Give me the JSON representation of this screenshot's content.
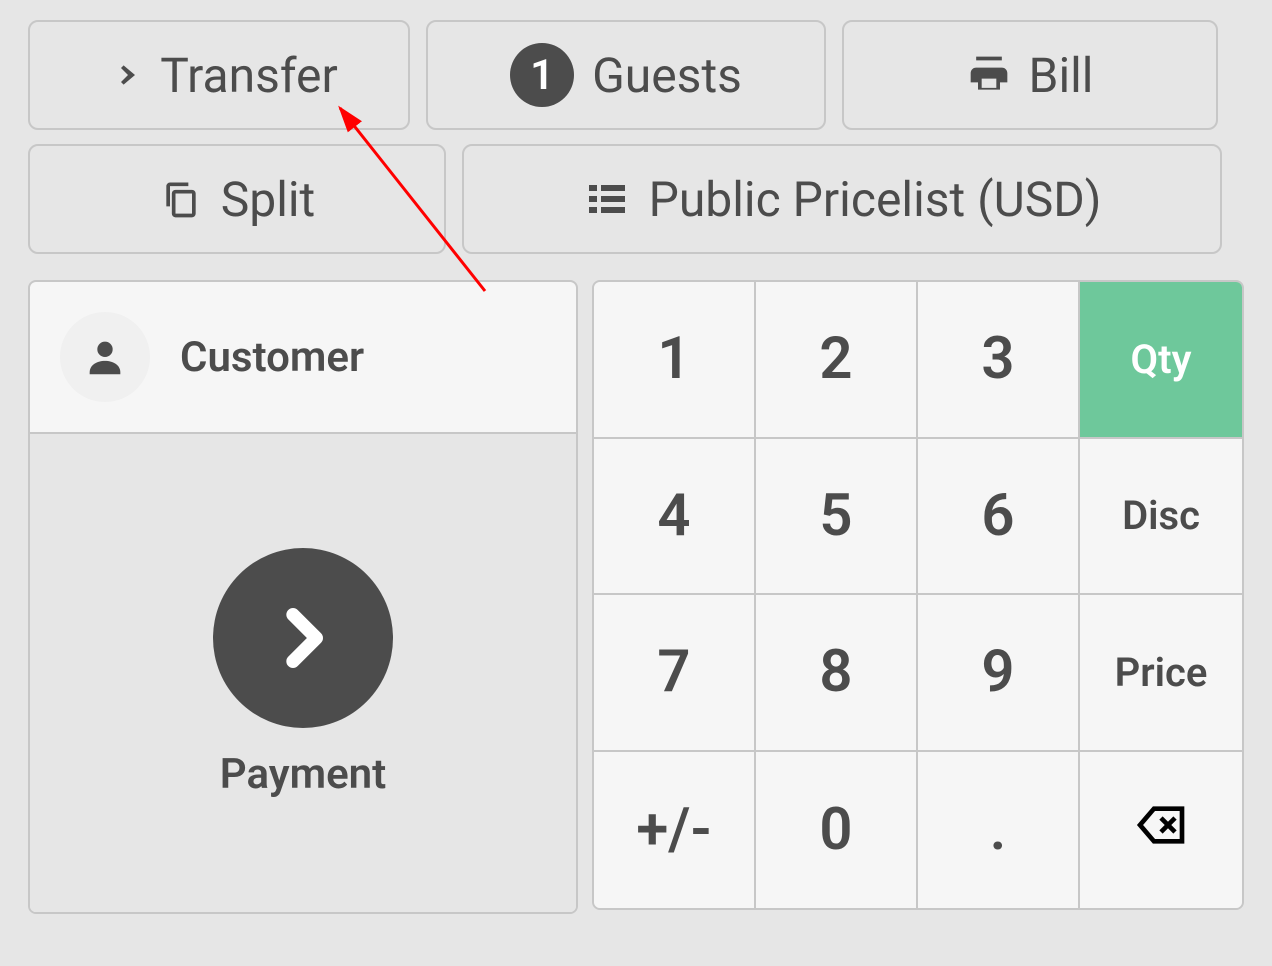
{
  "buttons": {
    "transfer": "Transfer",
    "guests": "Guests",
    "guests_count": "1",
    "bill": "Bill",
    "split": "Split",
    "pricelist": "Public Pricelist (USD)"
  },
  "customer": {
    "label": "Customer"
  },
  "payment": {
    "label": "Payment"
  },
  "numpad": {
    "k1": "1",
    "k2": "2",
    "k3": "3",
    "qty": "Qty",
    "k4": "4",
    "k5": "5",
    "k6": "6",
    "disc": "Disc",
    "k7": "7",
    "k8": "8",
    "k9": "9",
    "price": "Price",
    "pm": "+/-",
    "k0": "0",
    "dot": "."
  }
}
